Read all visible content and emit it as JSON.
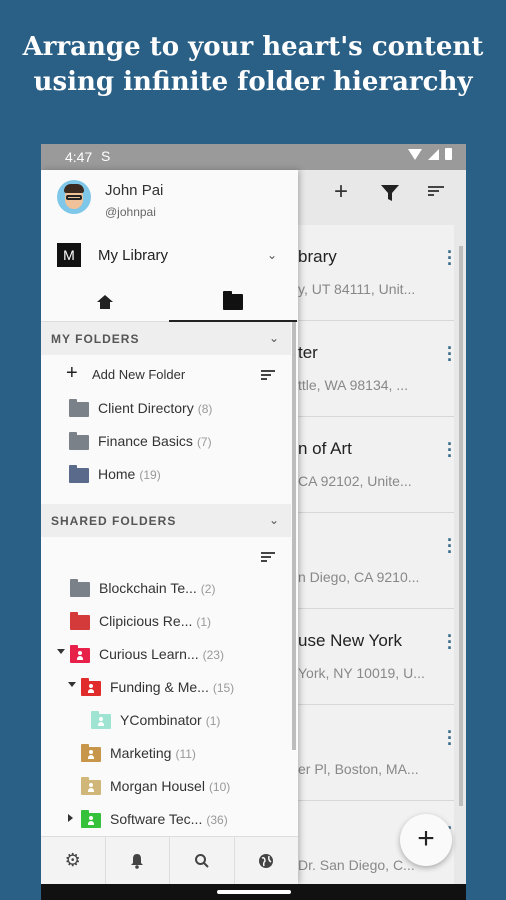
{
  "headline": {
    "line1": "Arrange to your heart's content",
    "line2": "using infinite folder hierarchy"
  },
  "status_bar": {
    "time": "4:47",
    "sync_icon": "S"
  },
  "profile": {
    "name": "John Pai",
    "handle": "@johnpai",
    "avatar": "avatar-icon"
  },
  "library": {
    "icon_letter": "M",
    "name": "My Library"
  },
  "tabs": [
    {
      "icon": "home-icon",
      "active": false
    },
    {
      "icon": "folder-icon",
      "active": true
    }
  ],
  "my_folders": {
    "header": "MY FOLDERS",
    "add_label": "Add New Folder",
    "items": [
      {
        "name": "Client Directory",
        "count": "(8)",
        "color": "#7a8189"
      },
      {
        "name": "Finance Basics",
        "count": "(7)",
        "color": "#7a8189"
      },
      {
        "name": "Home",
        "count": "(19)",
        "color": "#5a6a8a"
      }
    ]
  },
  "shared_folders": {
    "header": "SHARED FOLDERS",
    "items": [
      {
        "name": "Blockchain Te...",
        "count": "(2)",
        "color": "#7a8189",
        "shared": false
      },
      {
        "name": "Clipicious Re...",
        "count": "(1)",
        "color": "#d43a3a",
        "shared": false
      },
      {
        "name": "Curious Learn...",
        "count": "(23)",
        "color": "#e8214a",
        "shared": true
      },
      {
        "name": "Funding & Me...",
        "count": "(15)",
        "color": "#e12c2c",
        "shared": true
      },
      {
        "name": "YCombinator",
        "count": "(1)",
        "color": "#9fe3d2",
        "shared": true
      },
      {
        "name": "Marketing",
        "count": "(11)",
        "color": "#c8964a",
        "shared": true
      },
      {
        "name": "Morgan Housel",
        "count": "(10)",
        "color": "#d1b67a",
        "shared": true
      },
      {
        "name": "Software Tec...",
        "count": "(36)",
        "color": "#35c23a",
        "shared": true
      }
    ]
  },
  "bottom_bar": [
    "gear-icon",
    "bell-icon",
    "search-icon",
    "globe-icon"
  ],
  "background_list": {
    "toolbar": [
      "add-icon",
      "filter-icon",
      "sort-icon"
    ],
    "cards": [
      {
        "title": "brary",
        "subtitle": "y, UT 84111, Unit..."
      },
      {
        "title": "ter",
        "subtitle": "ttle, WA 98134, ..."
      },
      {
        "title": "n of Art",
        "subtitle": "CA 92102, Unite..."
      },
      {
        "title": "",
        "subtitle": "n Diego, CA 9210..."
      },
      {
        "title": "use New York",
        "subtitle": "York, NY 10019, U..."
      },
      {
        "title": "",
        "subtitle": "er Pl, Boston, MA..."
      },
      {
        "title": "",
        "subtitle": "Dr. San Diego, C..."
      }
    ],
    "fab": "+"
  }
}
